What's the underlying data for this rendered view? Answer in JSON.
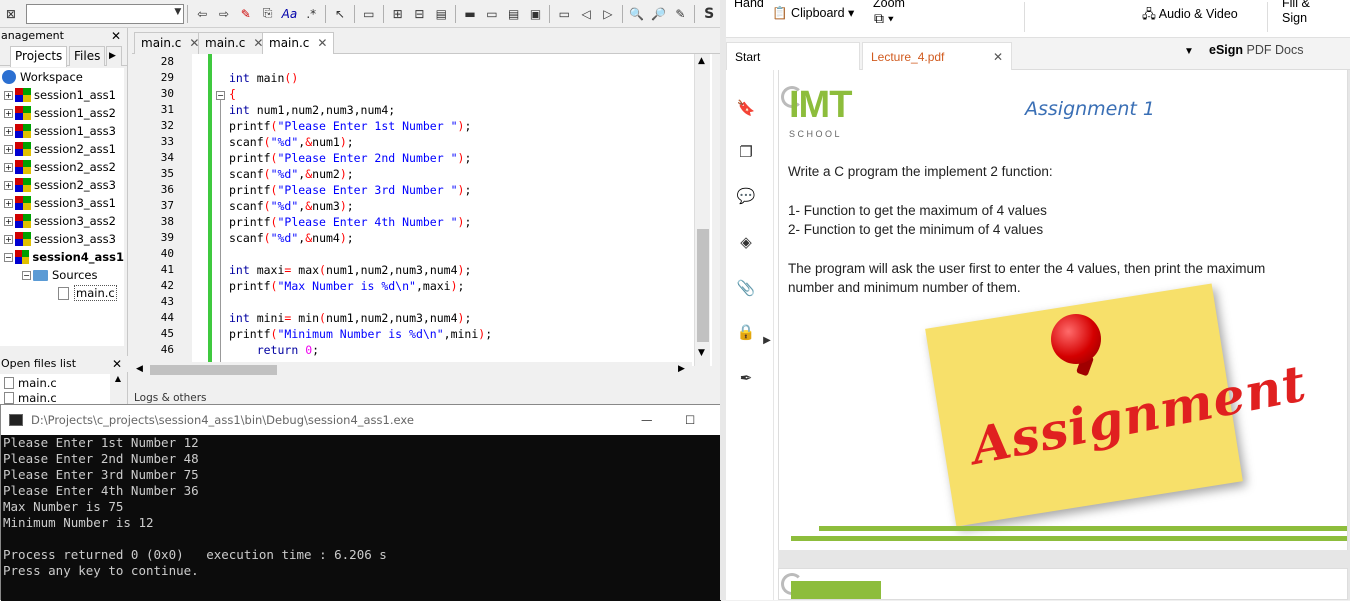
{
  "ide": {
    "toolbar": {
      "bold_s": "S"
    },
    "management": {
      "title": "anagement",
      "tabs": [
        "Projects",
        "Files"
      ],
      "workspace": "Workspace",
      "projects": [
        "session1_ass1",
        "session1_ass2",
        "session1_ass3",
        "session2_ass1",
        "session2_ass2",
        "session2_ass3",
        "session3_ass1",
        "session3_ass2",
        "session3_ass3",
        "session4_ass1"
      ],
      "sources": "Sources",
      "file": "main.c"
    },
    "open_files": {
      "title": "Open files list",
      "items": [
        "main.c",
        "main.c"
      ]
    },
    "editor_tabs": [
      "main.c",
      "main.c",
      "main.c"
    ],
    "line_numbers": [
      "28",
      "29",
      "30",
      "31",
      "32",
      "33",
      "34",
      "35",
      "36",
      "37",
      "38",
      "39",
      "40",
      "41",
      "42",
      "43",
      "44",
      "45",
      "46"
    ],
    "logs_label": "Logs & others"
  },
  "console": {
    "title": "D:\\Projects\\c_projects\\session4_ass1\\bin\\Debug\\session4_ass1.exe",
    "lines": [
      "Please Enter 1st Number 12",
      "Please Enter 2nd Number 48",
      "Please Enter 3rd Number 75",
      "Please Enter 4th Number 36",
      "Max Number is 75",
      "Minimum Number is 12",
      "",
      "Process returned 0 (0x0)   execution time : 6.206 s",
      "Press any key to continue."
    ]
  },
  "pdf": {
    "ribbon": {
      "hand": "Hand",
      "clipboard": "Clipboard",
      "zoom": "Zoom",
      "audio_video": "Audio & Video",
      "fill_sign": "Fill &",
      "fill_sign2": "Sign"
    },
    "tabs": [
      "Start",
      "Lecture_4.pdf"
    ],
    "esign": "eSign",
    "pdf_docs": "PDF Docs",
    "logo_text": "IMT",
    "logo_sub": "S C H O O L",
    "heading": "Assignment 1",
    "intro": "Write a C program the implement 2 function:",
    "items": [
      "1- Function to get the maximum of 4 values",
      "2- Function to get the minimum of 4 values"
    ],
    "para1": "The program will ask the user first to enter the 4 values, then print the maximum",
    "para2": "number and minimum number of them.",
    "note_text": "Assignment",
    "colors": {
      "heading": "#3a6fb5",
      "logo_green": "#8dbd3c",
      "note": "#f7e06a",
      "note_text": "#e02020"
    }
  }
}
